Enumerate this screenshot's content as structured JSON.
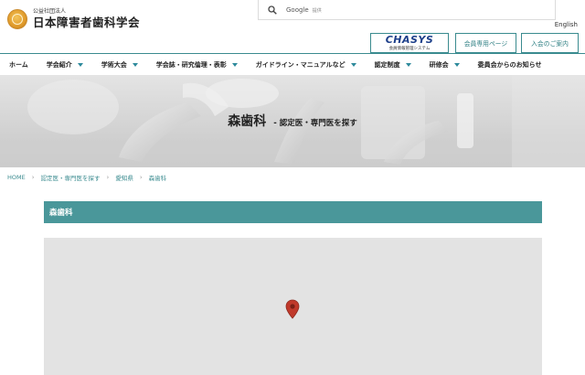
{
  "header": {
    "logo_sub": "公益社団法人",
    "logo_main": "日本障害者歯科学会",
    "search_label": "Google",
    "search_label_ja": "提供",
    "english_link": "English",
    "chasys_logo": "CHASYS",
    "chasys_sub": "会員情報管理システム",
    "member_page_button": "会員専用ページ",
    "join_button": "入会のご案内"
  },
  "nav": {
    "items": [
      {
        "label": "ホーム",
        "caret": false
      },
      {
        "label": "学会紹介",
        "caret": true
      },
      {
        "label": "学術大会",
        "caret": true
      },
      {
        "label": "学会誌・研究倫理・表彰",
        "caret": true
      },
      {
        "label": "ガイドライン・マニュアルなど",
        "caret": true
      },
      {
        "label": "認定制度",
        "caret": true
      },
      {
        "label": "研修会",
        "caret": true
      },
      {
        "label": "委員会からのお知らせ",
        "caret": false
      }
    ]
  },
  "hero": {
    "title": "森歯科",
    "subtitle": "- 認定医・専門医を探す"
  },
  "breadcrumb": [
    "HOME",
    "認定医・専門医を探す",
    "愛知県",
    "森歯科"
  ],
  "section": {
    "heading": "森歯科"
  },
  "colors": {
    "teal": "#4a979a",
    "nav_caret": "#2e8a9c",
    "pin_red": "#c0392b"
  },
  "icons": {
    "search": "search-icon",
    "pin": "map-pin-icon"
  }
}
